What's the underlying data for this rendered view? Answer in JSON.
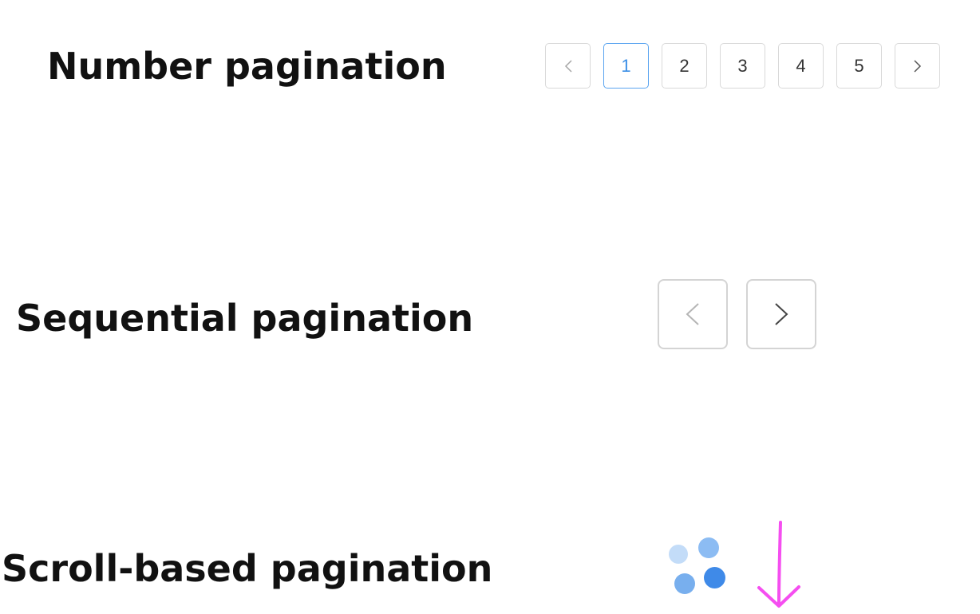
{
  "sections": {
    "number": {
      "title": "Number pagination",
      "pages": [
        "1",
        "2",
        "3",
        "4",
        "5"
      ],
      "active_page": "1",
      "prev_icon": "chevron-left-icon",
      "next_icon": "chevron-right-icon"
    },
    "sequential": {
      "title": "Sequential pagination",
      "prev_icon": "chevron-left-icon",
      "next_icon": "chevron-right-icon"
    },
    "scroll": {
      "title": "Scroll-based pagination",
      "loader_icon": "loading-dots-icon",
      "arrow_icon": "arrow-down-icon"
    }
  },
  "colors": {
    "active_border": "#5aa4f0",
    "active_text": "#3a8ee6",
    "border": "#d9d9d9",
    "loader_dark": "#3a86e8",
    "loader_light": "#b9d6f7",
    "arrow": "#f54ef0"
  }
}
